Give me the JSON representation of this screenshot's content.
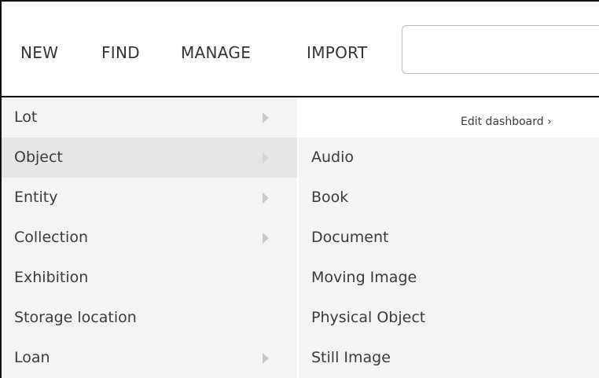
{
  "topnav": {
    "items": [
      {
        "id": "new",
        "label": "NEW"
      },
      {
        "id": "find",
        "label": "FIND"
      },
      {
        "id": "manage",
        "label": "MANAGE"
      },
      {
        "id": "import",
        "label": "IMPORT"
      }
    ],
    "search": {
      "value": "",
      "placeholder": ""
    }
  },
  "dashboard": {
    "edit_label": "Edit dashboard ›"
  },
  "menu": {
    "items": [
      {
        "label": "Lot",
        "has_submenu": true
      },
      {
        "label": "Object",
        "has_submenu": true,
        "active": true
      },
      {
        "label": "Entity",
        "has_submenu": true
      },
      {
        "label": "Collection",
        "has_submenu": true
      },
      {
        "label": "Exhibition",
        "has_submenu": false
      },
      {
        "label": "Storage location",
        "has_submenu": false
      },
      {
        "label": "Loan",
        "has_submenu": true
      }
    ]
  },
  "submenu": {
    "items": [
      {
        "label": "Audio"
      },
      {
        "label": "Book"
      },
      {
        "label": "Document"
      },
      {
        "label": "Moving Image"
      },
      {
        "label": "Physical Object"
      },
      {
        "label": "Still Image"
      }
    ]
  }
}
